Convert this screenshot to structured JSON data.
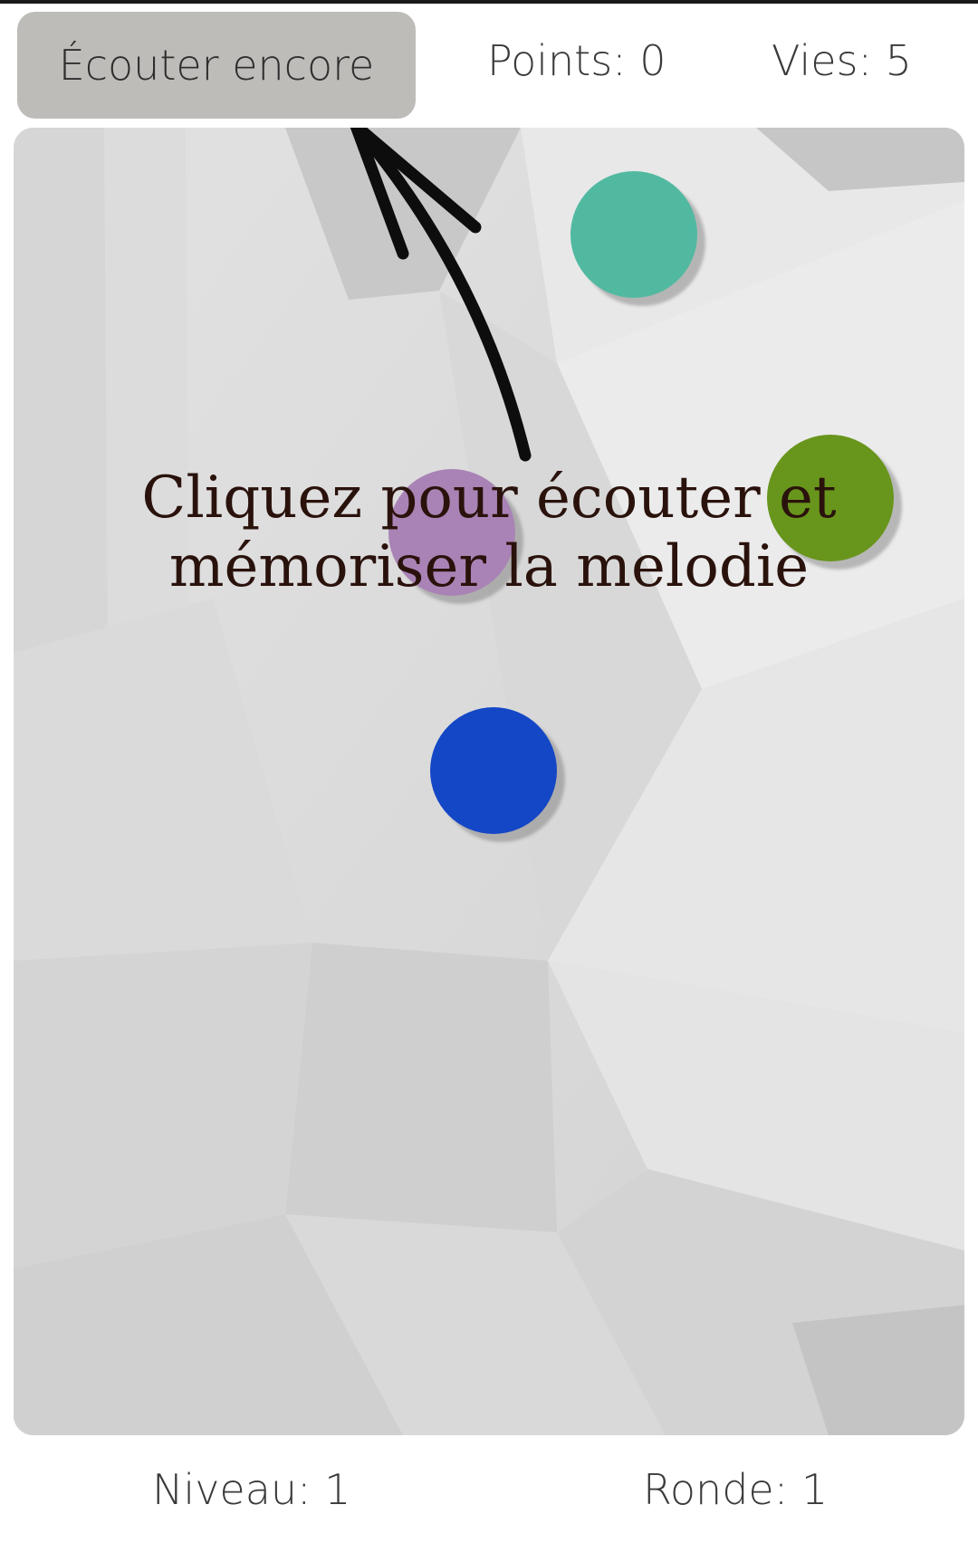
{
  "header": {
    "listen_again_label": "Écouter encore",
    "points_text": "Points: 0",
    "lives_text": "Vies: 5"
  },
  "board": {
    "instruction": "Cliquez pour écouter et mémoriser la melodie",
    "dots": [
      {
        "name": "teal-dot",
        "color": "#52b9a1"
      },
      {
        "name": "green-dot",
        "color": "#68951c"
      },
      {
        "name": "purple-dot",
        "color": "#a983b5"
      },
      {
        "name": "blue-dot",
        "color": "#1447c6"
      }
    ]
  },
  "footer": {
    "level_text": "Niveau: 1",
    "round_text": "Ronde: 1"
  }
}
